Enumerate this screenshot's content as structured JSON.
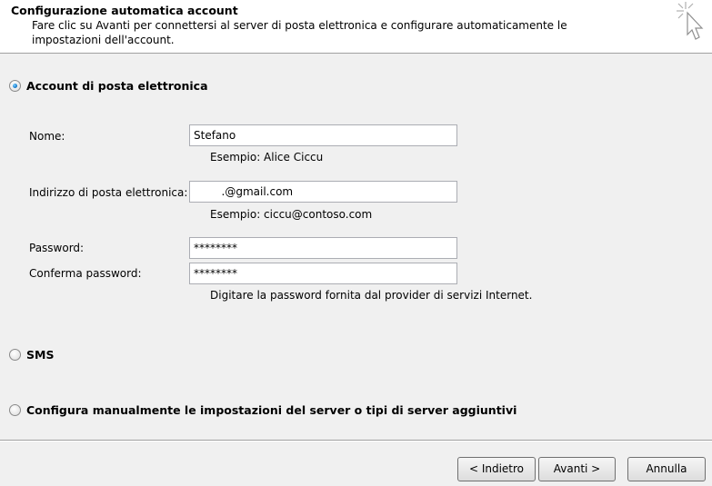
{
  "header": {
    "title": "Configurazione automatica account",
    "description": "Fare clic su Avanti per connettersi al server di posta elettronica e configurare automaticamente le impostazioni dell'account."
  },
  "options": {
    "email_account": {
      "label": "Account di posta elettronica",
      "selected": true
    },
    "sms": {
      "label": "SMS",
      "selected": false
    },
    "manual": {
      "label": "Configura manualmente le impostazioni del server o tipi di server aggiuntivi",
      "selected": false
    }
  },
  "form": {
    "name": {
      "label": "Nome:",
      "value": "Stefano",
      "hint": "Esempio: Alice Ciccu"
    },
    "email": {
      "label": "Indirizzo di posta elettronica:",
      "value": "        .@gmail.com",
      "hint": "Esempio: ciccu@contoso.com"
    },
    "password": {
      "label": "Password:",
      "value": "********"
    },
    "confirm_password": {
      "label": "Conferma password:",
      "value": "********"
    },
    "password_hint": "Digitare la password fornita dal provider di servizi Internet."
  },
  "buttons": {
    "back": "< Indietro",
    "next": "Avanti >",
    "cancel": "Annulla"
  }
}
